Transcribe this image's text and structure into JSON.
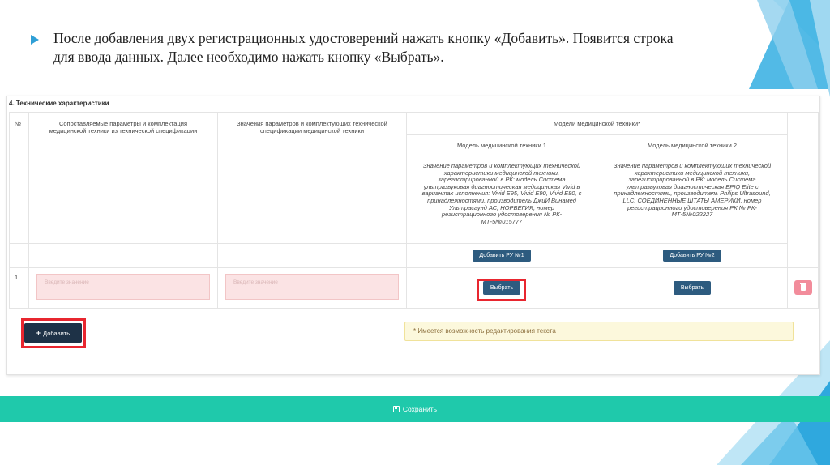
{
  "slide": {
    "text_line1": "После добавления двух регистрационных удостоверений нажать кнопку «Добавить». Появится строка",
    "text_line2": "для ввода данных. Далее необходимо нажать кнопку «Выбрать»."
  },
  "section": {
    "title": "4. Технические характеристики"
  },
  "table": {
    "col_num": "№",
    "col_params": "Сопоставляемые параметры и комплектация медицинской техники из технической спецификации",
    "col_values": "Значения параметров и комплектующих технической спецификации медицинской техники",
    "col_models": "Модели медицинской техники*",
    "models": [
      {
        "title": "Модель медицинской техники 1",
        "description": "Значение параметров и комплектующих технической характеристики медицинской техники, зарегистрированной в РК: модель Система ультразвуковая диагностическая медицинская Vivid в вариантах исполнения: Vivid E95, Vivid E90, Vivid E80, с принадлежностями, производитель ДжиИ Винамед Ультрасаунд АС, НОРВЕГИЯ, номер регистрационного удостоверения № РК-МТ-5№015777",
        "add_button": "Добавить РУ №1",
        "select_button": "Выбрать"
      },
      {
        "title": "Модель медицинской техники 2",
        "description": "Значение параметров и комплектующих технической характеристики медицинской техники, зарегистрированной в РК: модель Система ультразвуковая диагностическая EPIQ Elite с принадлежностями, производитель Philips Ultrasound, LLC, СОЕДИНЁННЫЕ ШТАТЫ АМЕРИКИ, номер регистрационного удостоверения РК № РК-МТ-5№022227",
        "add_button": "Добавить РУ №2",
        "select_button": "Выбрать"
      }
    ],
    "row": {
      "num": "1",
      "param_placeholder": "Введите значение",
      "value_placeholder": "Введите значение"
    }
  },
  "actions": {
    "add_label": "Добавить",
    "notice": "* Имеется возможность редактирования текста",
    "save_label": "Сохранить"
  },
  "colors": {
    "accent_blue": "#2d5b7f",
    "save_bar": "#1fc9ab",
    "highlight_red": "#e8262f"
  }
}
